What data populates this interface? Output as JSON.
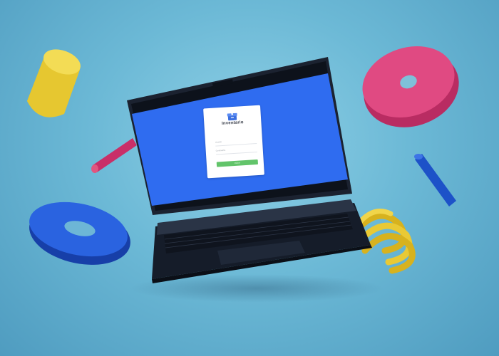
{
  "login": {
    "app_title": "Inventario",
    "username_label": "Usuario",
    "password_label": "Contraseña",
    "submit_label": "Iniciar"
  },
  "colors": {
    "background": "#6cb9d6",
    "screen_blue": "#2f6cf0",
    "laptop_body": "#1c2433",
    "button_green": "#62c46a",
    "yellow": "#e6c730",
    "pink": "#d63f78",
    "blue_shape": "#1f5ad4"
  },
  "icons": [
    "inventory-box-icon"
  ]
}
